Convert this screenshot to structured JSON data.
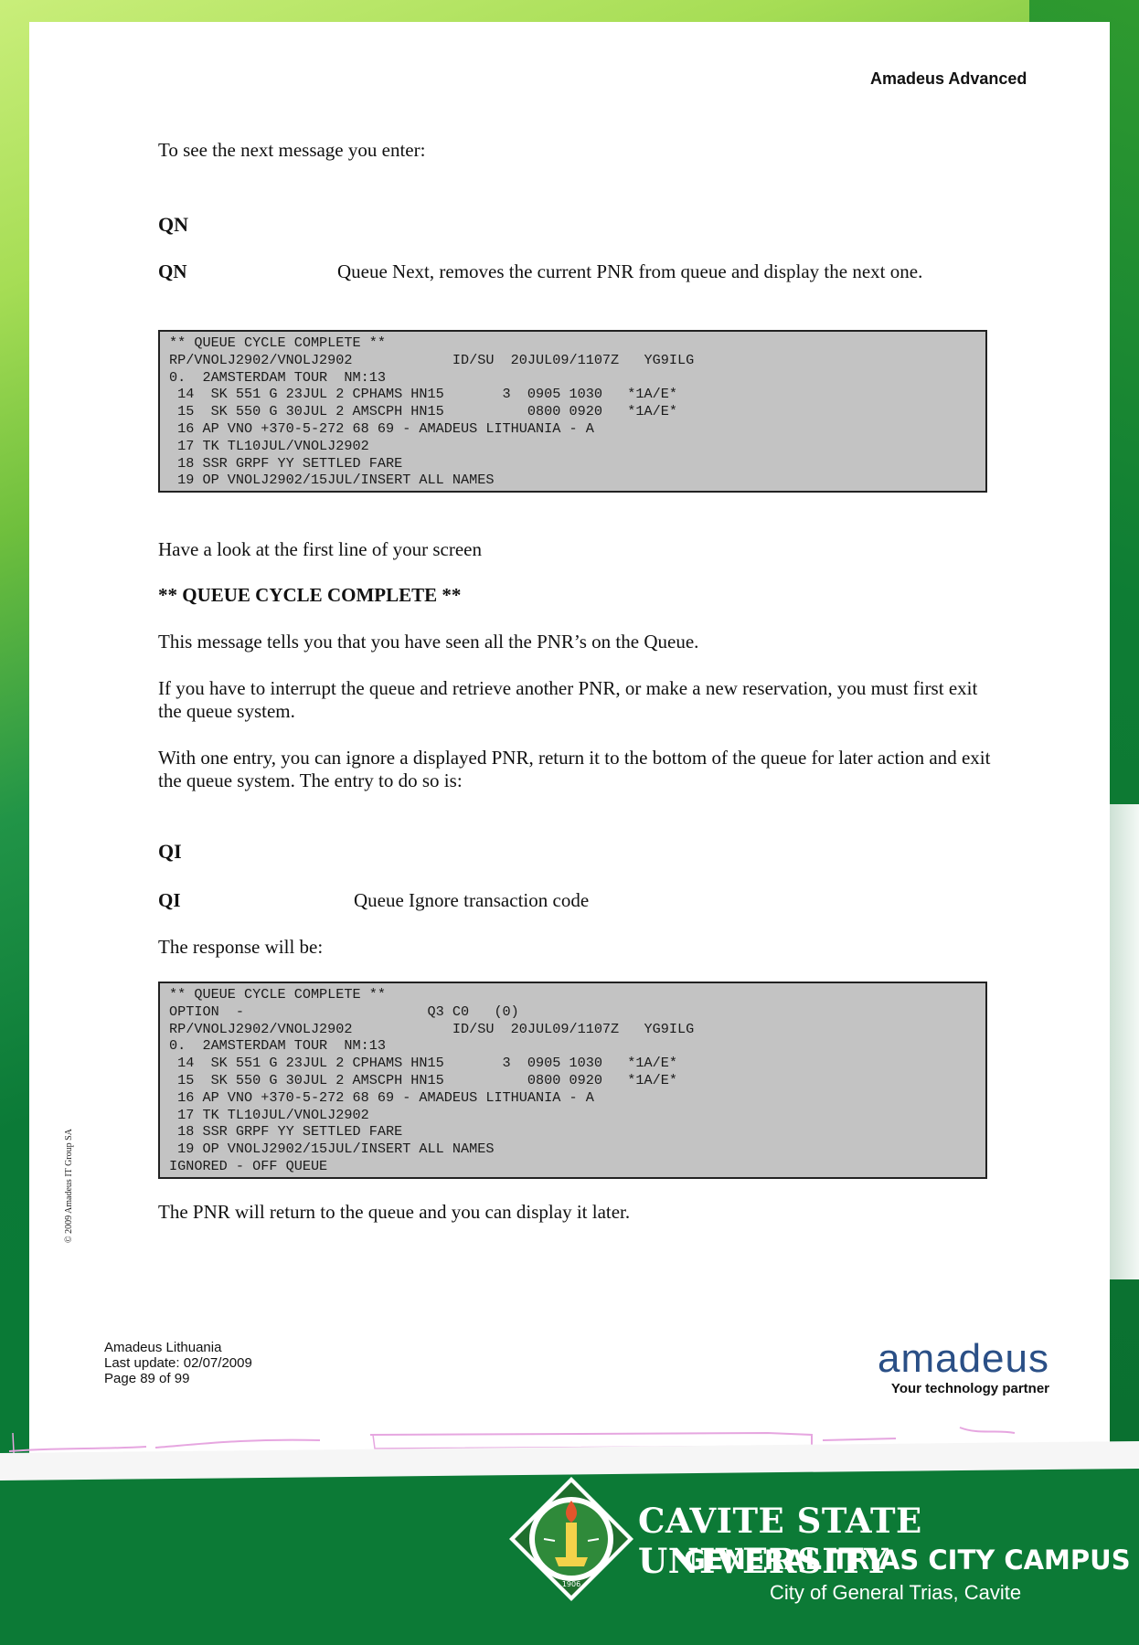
{
  "header": {
    "title": "Amadeus Advanced"
  },
  "intro": "To see the next message you enter:",
  "qn": {
    "heading": "QN",
    "code": "QN",
    "definition": "Queue Next, removes the current PNR from queue and display the next one."
  },
  "screen1": [
    "** QUEUE CYCLE COMPLETE **",
    "RP/VNOLJ2902/VNOLJ2902            ID/SU  20JUL09/1107Z   YG9ILG",
    "0.  2AMSTERDAM TOUR  NM:13",
    " 14  SK 551 G 23JUL 2 CPHAMS HN15       3  0905 1030   *1A/E*",
    " 15  SK 550 G 30JUL 2 AMSCPH HN15          0800 0920   *1A/E*",
    " 16 AP VNO +370-5-272 68 69 - AMADEUS LITHUANIA - A",
    " 17 TK TL10JUL/VNOLJ2902",
    " 18 SSR GRPF YY SETTLED FARE",
    " 19 OP VNOLJ2902/15JUL/INSERT ALL NAMES"
  ],
  "look_line": "Have a look at the first line of your screen",
  "complete_heading": "** QUEUE CYCLE COMPLETE **",
  "complete_text": "This message tells you that you have seen all the PNR’s on the Queue.",
  "interrupt_text": "If you have to interrupt the queue and retrieve another PNR, or make a new reservation, you must first exit the queue system.",
  "ignore_text": "With one entry, you can ignore a displayed PNR, return it to the bottom of the queue for later action and exit the queue system. The entry to do so is:",
  "qi": {
    "heading": "QI",
    "code": "QI",
    "definition": "Queue Ignore transaction code"
  },
  "response_text": "The response will be:",
  "screen2": [
    "** QUEUE CYCLE COMPLETE **",
    "OPTION  -                      Q3 C0   (0)",
    "RP/VNOLJ2902/VNOLJ2902            ID/SU  20JUL09/1107Z   YG9ILG",
    "0.  2AMSTERDAM TOUR  NM:13",
    " 14  SK 551 G 23JUL 2 CPHAMS HN15       3  0905 1030   *1A/E*",
    " 15  SK 550 G 30JUL 2 AMSCPH HN15          0800 0920   *1A/E*",
    " 16 AP VNO +370-5-272 68 69 - AMADEUS LITHUANIA - A",
    " 17 TK TL10JUL/VNOLJ2902",
    " 18 SSR GRPF YY SETTLED FARE",
    " 19 OP VNOLJ2902/15JUL/INSERT ALL NAMES",
    "IGNORED - OFF QUEUE"
  ],
  "final_text": "The PNR will return to the queue and you can display it later.",
  "copyright": "© 2009 Amadeus IT Group SA",
  "footer": {
    "line1": "Amadeus Lithuania",
    "line2": "Last update: 02/07/2009",
    "line3": "Page 89 of 99"
  },
  "logo": {
    "word": "amadeus",
    "tagline": "Your technology partner",
    "color": "#2a4f86"
  },
  "banner": {
    "name": "CAVITE STATE UNIVERSITY",
    "campus": "GENERAL TRIAS CITY CAMPUS",
    "location": "City of General Trias, Cavite",
    "seal_year": "1906"
  }
}
